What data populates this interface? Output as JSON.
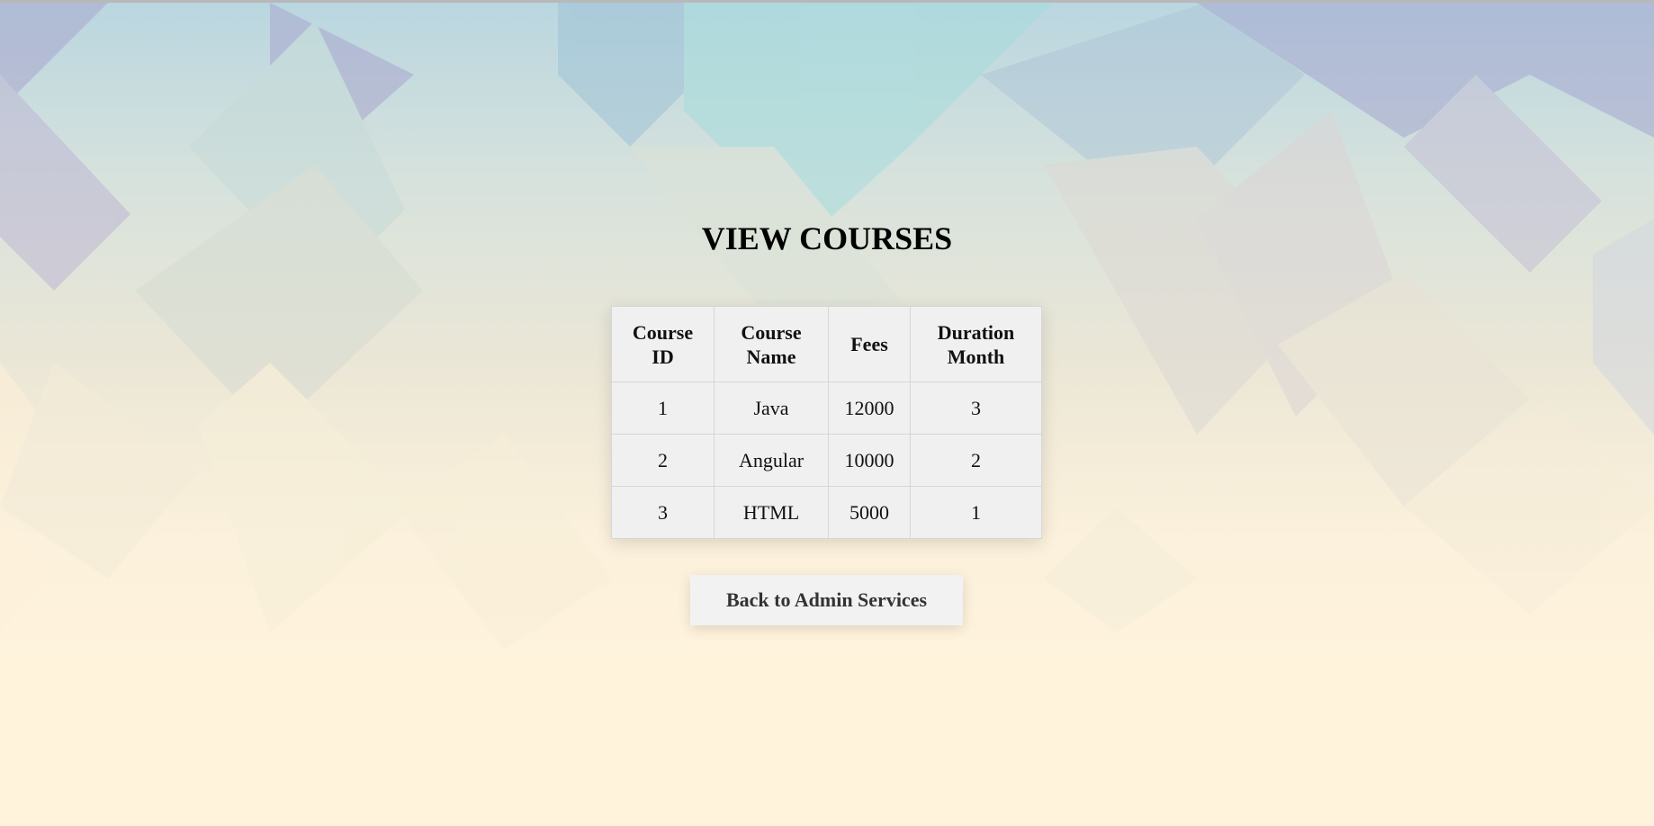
{
  "page": {
    "title": "VIEW COURSES"
  },
  "courses_table": {
    "headers": [
      {
        "line1": "Course",
        "line2": "ID"
      },
      {
        "line1": "Course",
        "line2": "Name"
      },
      {
        "line1": "Fees",
        "line2": ""
      },
      {
        "line1": "Duration",
        "line2": "Month"
      }
    ],
    "rows": [
      {
        "id": "1",
        "name": "Java",
        "fees": "12000",
        "duration": "3"
      },
      {
        "id": "2",
        "name": "Angular",
        "fees": "10000",
        "duration": "2"
      },
      {
        "id": "3",
        "name": "HTML",
        "fees": "5000",
        "duration": "1"
      }
    ]
  },
  "actions": {
    "back_label": "Back to Admin Services"
  },
  "colors": {
    "table_bg": "#f0f0f0",
    "button_bg": "#f2f2f2",
    "text": "#111111",
    "background_top": "#b9d6e0",
    "background_bottom": "#fff3dc"
  }
}
